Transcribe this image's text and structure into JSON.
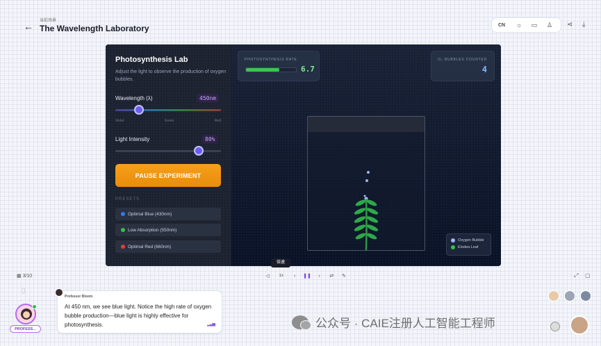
{
  "header": {
    "breadcrumb": "当前场景",
    "title": "The Wavelength Laboratory",
    "lang_button": "CN",
    "icons": [
      "back-arrow-icon",
      "sun-icon",
      "presentation-icon",
      "user-icon",
      "share-icon",
      "download-icon"
    ]
  },
  "lab": {
    "panel_title": "Photosynthesis Lab",
    "panel_subtitle": "Adjust the light to observe the production of oxygen bubbles.",
    "wavelength": {
      "label": "Wavelength (λ)",
      "value": "450nm",
      "level": 0.2
    },
    "spectrum_ticks": [
      "Violet",
      "Green",
      "Red"
    ],
    "intensity": {
      "label": "Light Intensity",
      "value": "80%",
      "level": 0.8
    },
    "pause_button": "PAUSE EXPERIMENT",
    "presets_label": "PRESETS",
    "presets": [
      {
        "label": "Optimal Blue (430nm)",
        "color": "#2f7cf6"
      },
      {
        "label": "Low Absorption (550nm)",
        "color": "#35c24a"
      },
      {
        "label": "Optimal Red (660nm)",
        "color": "#e63b3b"
      }
    ],
    "rate": {
      "label": "PHOTOSYNTHESIS RATE",
      "value": "6.7",
      "fill": 0.67
    },
    "bubbles": {
      "label": "O₂ BUBBLES COUNTED",
      "value": "4"
    },
    "legend": [
      {
        "label": "Oxygen Bubble",
        "color": "#9fb4ff"
      },
      {
        "label": "Elodea Leaf",
        "color": "#35c24a"
      }
    ]
  },
  "controls": {
    "page": "3/10",
    "tooltip": "倍速",
    "speed": "1x"
  },
  "chat": {
    "speaker": "Professor Bloom",
    "message": "At 450 nm, we see blue light. Notice the high rate of oxygen bubble production—blue light is highly effective for photosynthesis.",
    "badge": "PROFESS..."
  },
  "watermark": "公众号 · CAIE注册人工智能工程师"
}
